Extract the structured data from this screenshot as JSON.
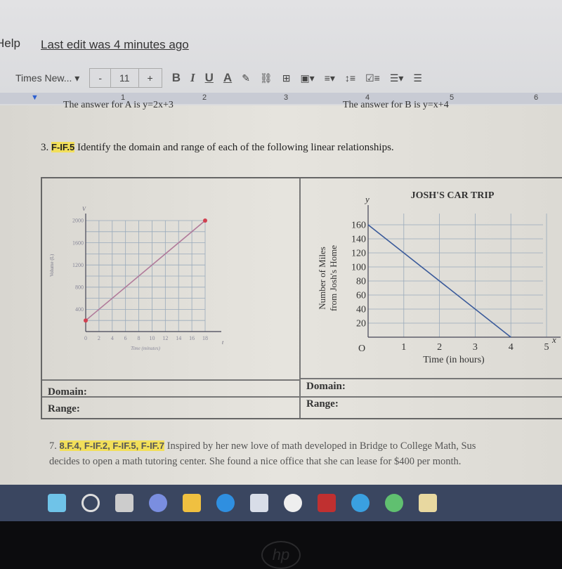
{
  "menu": {
    "help": "Help",
    "last_edit": "Last edit was 4 minutes ago"
  },
  "toolbar": {
    "font": "Times New...",
    "font_size": "11",
    "minus": "-",
    "plus": "+",
    "bold": "B",
    "italic": "I",
    "underline": "U",
    "text_color": "A"
  },
  "ruler": [
    "1",
    "2",
    "3",
    "4",
    "5",
    "6"
  ],
  "doc": {
    "prev_a": "The answer for A is y=2x+3",
    "prev_b": "The answer for B is y=x+4",
    "q3_num": "3.",
    "q3_std": "F-IF.5",
    "q3_text": "Identify the domain and range of each of the following linear relationships.",
    "domain_label": "Domain:",
    "range_label": "Range:",
    "q7_num": "7.",
    "q7_std": "8.F.4, F-IF.2, F-IF.5, F-IF.7",
    "q7_line1": "Inspired by her new love of math developed in Bridge to College Math, Sus",
    "q7_line2": "decides to open a math tutoring center. She found a nice office that she can lease for $400 per month."
  },
  "chart_data": [
    {
      "type": "line",
      "ylabel": "Volume (L)",
      "xlabel": "Time (minutes)",
      "y_axis_letter": "V",
      "x_axis_letter": "t",
      "xlim": [
        0,
        18
      ],
      "ylim": [
        0,
        2000
      ],
      "xticks": [
        0,
        2,
        4,
        6,
        8,
        10,
        12,
        14,
        16,
        18
      ],
      "yticks": [
        400,
        800,
        1200,
        1600,
        2000
      ],
      "grid": true,
      "points": [
        [
          0,
          200
        ],
        [
          18,
          2000
        ]
      ],
      "line_color": "#b07a9a",
      "endpoint_color": "#d04050"
    },
    {
      "type": "line",
      "title": "JOSH'S CAR TRIP",
      "ylabel": "Number of Miles from Josh's Home",
      "xlabel": "Time (in hours)",
      "y_axis_letter": "y",
      "x_axis_letter": "x",
      "origin_label": "O",
      "xlim": [
        0,
        5
      ],
      "ylim": [
        0,
        160
      ],
      "xticks": [
        1,
        2,
        3,
        4,
        5
      ],
      "yticks": [
        20,
        40,
        60,
        80,
        100,
        120,
        140,
        160
      ],
      "grid": true,
      "points": [
        [
          0,
          160
        ],
        [
          4,
          0
        ]
      ],
      "line_color": "#3a5a9a"
    }
  ],
  "taskbar": {
    "icons": [
      "windows-start-icon",
      "search-icon",
      "task-view-icon",
      "chat-icon",
      "file-explorer-icon",
      "edge-icon",
      "store-icon",
      "app-icon",
      "mcafee-icon",
      "help-icon",
      "chrome-icon",
      "files-icon"
    ]
  },
  "bezel_logo": "hp"
}
